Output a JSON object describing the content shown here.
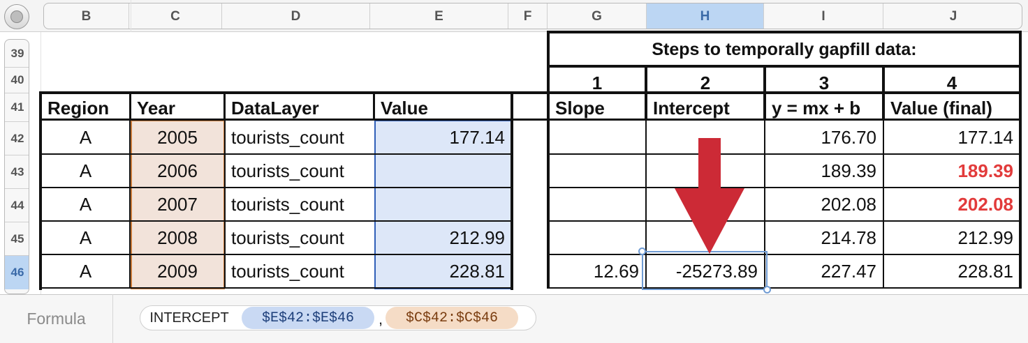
{
  "columns": [
    {
      "key": "B",
      "label": "B"
    },
    {
      "key": "C",
      "label": "C"
    },
    {
      "key": "D",
      "label": "D"
    },
    {
      "key": "E",
      "label": "E"
    },
    {
      "key": "F",
      "label": "F"
    },
    {
      "key": "G",
      "label": "G"
    },
    {
      "key": "H",
      "label": "H",
      "selected": true
    },
    {
      "key": "I",
      "label": "I"
    },
    {
      "key": "J",
      "label": "J"
    }
  ],
  "rows": [
    "39",
    "40",
    "41",
    "42",
    "43",
    "44",
    "45",
    "46"
  ],
  "selected_row": "46",
  "steps_title": "Steps to temporally gapfill data:",
  "step_numbers": [
    "1",
    "2",
    "3",
    "4"
  ],
  "left_headers": [
    "Region",
    "Year",
    "DataLayer",
    "Value"
  ],
  "right_headers": [
    "Slope",
    "Intercept",
    "y = mx + b",
    "Value (final)"
  ],
  "data_rows": [
    {
      "region": "A",
      "year": "2005",
      "layer": "tourists_count",
      "value": "177.14",
      "slope": "",
      "intercept": "",
      "fit": "176.70",
      "final": "177.14",
      "final_highlight": false
    },
    {
      "region": "A",
      "year": "2006",
      "layer": "tourists_count",
      "value": "",
      "slope": "",
      "intercept": "",
      "fit": "189.39",
      "final": "189.39",
      "final_highlight": true
    },
    {
      "region": "A",
      "year": "2007",
      "layer": "tourists_count",
      "value": "",
      "slope": "",
      "intercept": "",
      "fit": "202.08",
      "final": "202.08",
      "final_highlight": true
    },
    {
      "region": "A",
      "year": "2008",
      "layer": "tourists_count",
      "value": "212.99",
      "slope": "",
      "intercept": "",
      "fit": "214.78",
      "final": "212.99",
      "final_highlight": false
    },
    {
      "region": "A",
      "year": "2009",
      "layer": "tourists_count",
      "value": "228.81",
      "slope": "12.69",
      "intercept": "-25273.89",
      "fit": "227.47",
      "final": "228.81",
      "final_highlight": false
    }
  ],
  "formula": {
    "label": "Formula",
    "function": "INTERCEPT",
    "arg1": "$E$42:$E$46",
    "separator": ",",
    "arg2": "$C$42:$C$46"
  },
  "colors": {
    "year_fill": "#f2e3da",
    "year_border": "#c77a3a",
    "value_fill": "#dde7f8",
    "value_border": "#2f5fb8",
    "arrow": "#cc2a36",
    "highlight_text": "#e23b3b",
    "selection": "#bcd6f3"
  },
  "icons": {
    "corner": "select-all-circle-icon",
    "arrow": "down-arrow-icon"
  }
}
